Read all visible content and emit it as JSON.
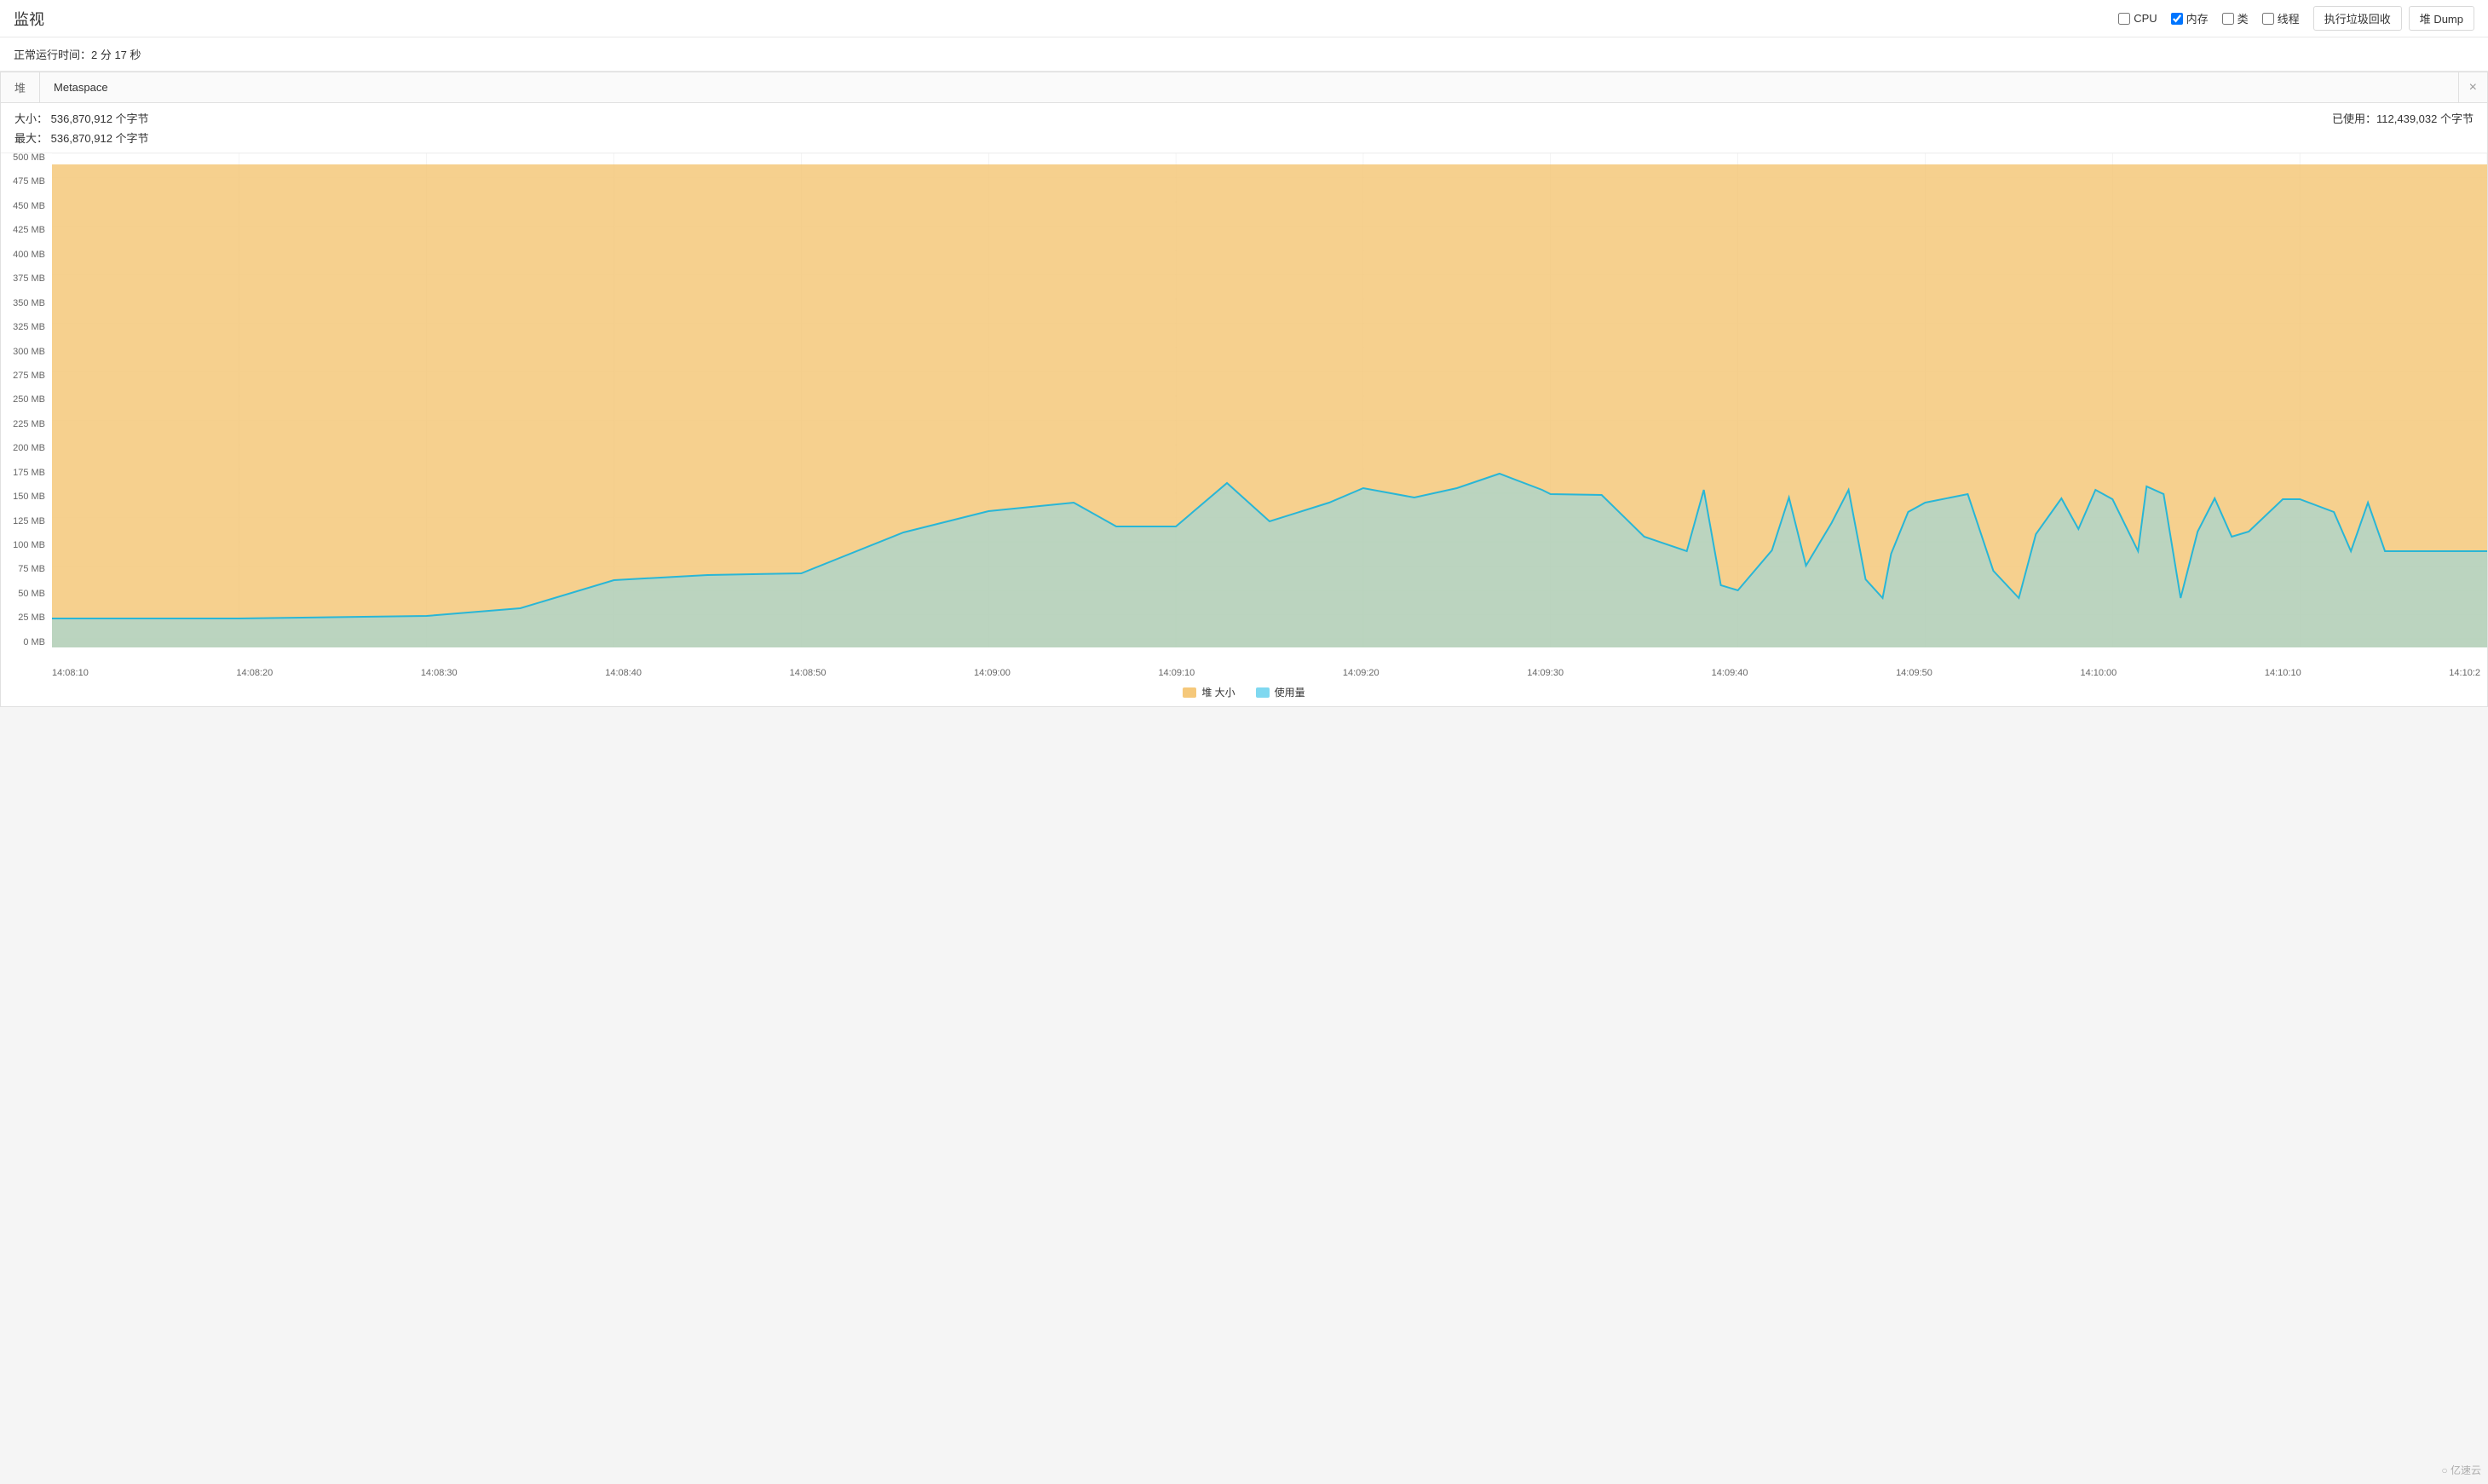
{
  "header": {
    "title": "监视",
    "uptime_label": "正常运行时间：2 分 17 秒"
  },
  "checkboxes": [
    {
      "id": "cpu",
      "label": "CPU",
      "checked": false
    },
    {
      "id": "memory",
      "label": "内存",
      "checked": true
    },
    {
      "id": "class",
      "label": "类",
      "checked": false
    },
    {
      "id": "thread",
      "label": "线程",
      "checked": false
    }
  ],
  "buttons": {
    "gc": "执行垃圾回收",
    "heap_dump": "堆 Dump"
  },
  "heap": {
    "tab_label": "堆",
    "tab_name": "Metaspace",
    "size_label": "大小：",
    "size_value": "536,870,912 个字节",
    "max_label": "最大：",
    "max_value": "536,870,912 个字节",
    "used_label": "已使用：",
    "used_value": "112,439,032 个字节",
    "close_icon": "×"
  },
  "chart": {
    "y_labels": [
      "500 MB",
      "475 MB",
      "450 MB",
      "425 MB",
      "400 MB",
      "375 MB",
      "350 MB",
      "325 MB",
      "300 MB",
      "275 MB",
      "250 MB",
      "225 MB",
      "200 MB",
      "175 MB",
      "150 MB",
      "125 MB",
      "100 MB",
      "75 MB",
      "50 MB",
      "25 MB",
      "0 MB"
    ],
    "x_labels": [
      "14:08:10",
      "14:08:20",
      "14:08:30",
      "14:08:40",
      "14:08:50",
      "14:09:00",
      "14:09:10",
      "14:09:20",
      "14:09:30",
      "14:09:40",
      "14:09:50",
      "14:10:00",
      "14:10:10",
      "14:10:2"
    ],
    "max_mb": 512,
    "size_fill_color": "#f5c87a",
    "used_fill_color": "#7fd8f0",
    "used_line_color": "#29b6d6"
  },
  "legend": [
    {
      "label": "堆 大小",
      "color": "#f5c87a"
    },
    {
      "label": "使用量",
      "color": "#7fd8f0"
    }
  ],
  "watermark": "○ 亿速云"
}
